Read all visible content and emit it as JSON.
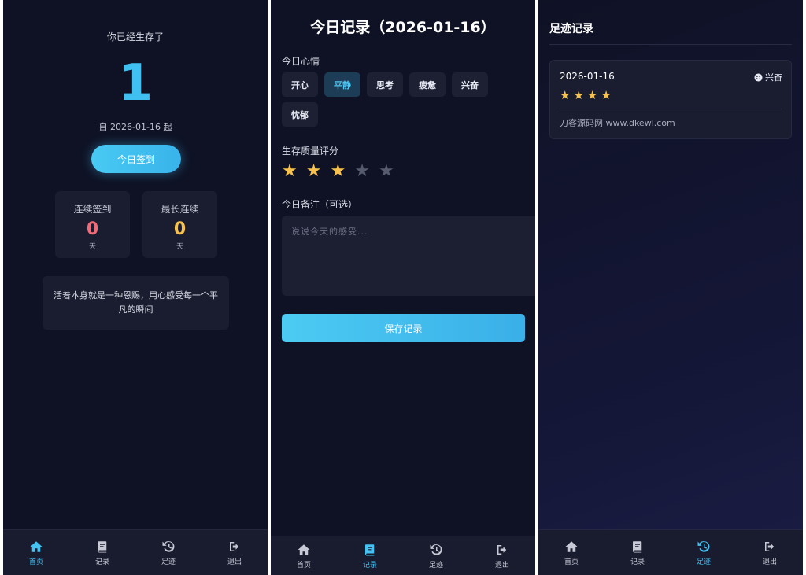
{
  "colors": {
    "background": "#0f1225",
    "accent": "#44c2f2",
    "danger": "#f06a78",
    "warning": "#f7c14d",
    "card": "#1a1d30"
  },
  "nav": {
    "items": [
      {
        "label": "首页",
        "icon": "home-icon"
      },
      {
        "label": "记录",
        "icon": "book-icon"
      },
      {
        "label": "足迹",
        "icon": "history-icon"
      },
      {
        "label": "退出",
        "icon": "logout-icon"
      }
    ]
  },
  "home": {
    "subtitle": "你已经生存了",
    "days": "1",
    "since": "自 2026-01-16 起",
    "checkin_label": "今日签到",
    "stats": [
      {
        "label": "连续签到",
        "value": "0",
        "unit": "天"
      },
      {
        "label": "最长连续",
        "value": "0",
        "unit": "天"
      }
    ],
    "quote": "活着本身就是一种恩赐，用心感受每一个平凡的瞬间"
  },
  "record": {
    "title": "今日记录（2026-01-16）",
    "mood_label": "今日心情",
    "moods": [
      "开心",
      "平静",
      "思考",
      "疲惫",
      "兴奋",
      "忧郁"
    ],
    "selected_mood": "平静",
    "quality_label": "生存质量评分",
    "rating": 3,
    "rating_max": 5,
    "note_label": "今日备注（可选）",
    "note_placeholder": "说说今天的感受...",
    "note_value": "",
    "save_label": "保存记录"
  },
  "footprints": {
    "title": "足迹记录",
    "entries": [
      {
        "date": "2026-01-16",
        "mood": "兴奋",
        "rating": 4,
        "note": "刀客源码网 www.dkewl.com"
      }
    ]
  }
}
